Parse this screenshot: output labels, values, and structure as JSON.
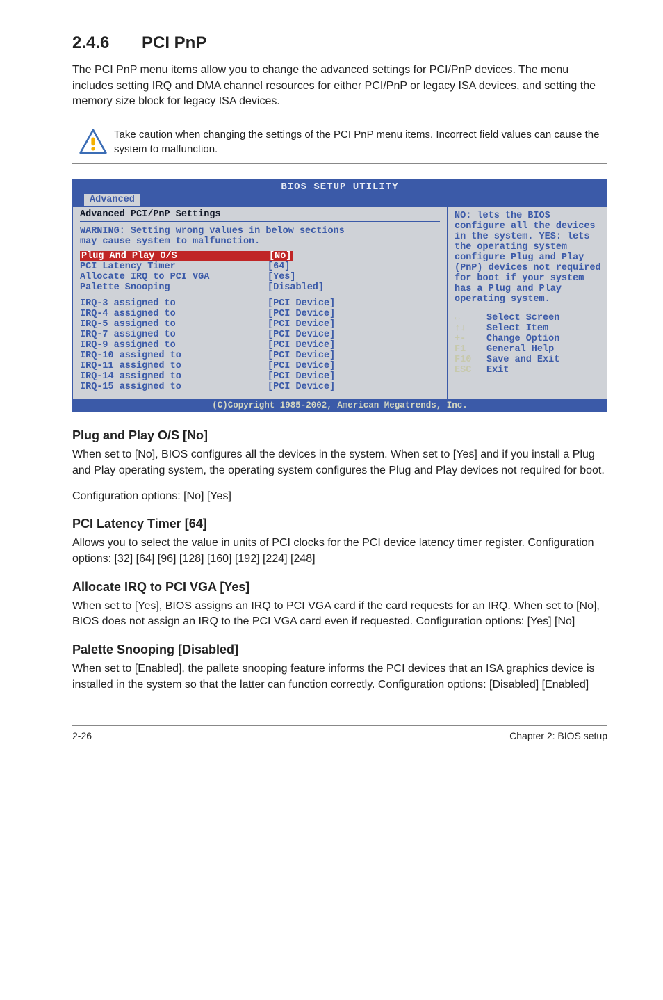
{
  "section": {
    "number": "2.4.6",
    "title": "PCI PnP"
  },
  "intro": "The PCI PnP menu items allow you to change the advanced settings for PCI/PnP devices. The menu includes setting IRQ and DMA channel resources for either PCI/PnP or legacy ISA devices, and setting the memory size block for legacy ISA devices.",
  "callout": "Take caution when changing the settings of the PCI PnP menu items. Incorrect field values can cause the system to malfunction.",
  "bios": {
    "titlebar": "BIOS SETUP UTILITY",
    "tab": "Advanced",
    "panel_title": "Advanced PCI/PnP Settings",
    "warning_l1": "WARNING: Setting wrong values in below sections",
    "warning_l2": "         may cause system to malfunction.",
    "opts": [
      {
        "label": "Plug And Play O/S",
        "value": "[No]",
        "sel": true
      },
      {
        "label": "PCI Latency Timer",
        "value": "[64]",
        "sel": false
      },
      {
        "label": "Allocate IRQ to PCI VGA",
        "value": "[Yes]",
        "sel": false
      },
      {
        "label": "Palette Snooping",
        "value": "[Disabled]",
        "sel": false
      }
    ],
    "irqs": [
      {
        "label": "IRQ-3 assigned to",
        "value": "[PCI Device]"
      },
      {
        "label": "IRQ-4 assigned to",
        "value": "[PCI Device]"
      },
      {
        "label": "IRQ-5 assigned to",
        "value": "[PCI Device]"
      },
      {
        "label": "IRQ-7 assigned to",
        "value": "[PCI Device]"
      },
      {
        "label": "IRQ-9 assigned to",
        "value": "[PCI Device]"
      },
      {
        "label": "IRQ-10 assigned to",
        "value": "[PCI Device]"
      },
      {
        "label": "IRQ-11 assigned to",
        "value": "[PCI Device]"
      },
      {
        "label": "IRQ-14 assigned to",
        "value": "[PCI Device]"
      },
      {
        "label": "IRQ-15 assigned to",
        "value": "[PCI Device]"
      }
    ],
    "help": "NO: lets the BIOS configure all the devices in the system. YES: lets the operating system configure Plug and Play (PnP) devices not required for boot if your system has a Plug and Play operating system.",
    "keys": [
      {
        "k": "↔",
        "a": "Select Screen"
      },
      {
        "k": "↑↓",
        "a": "Select Item"
      },
      {
        "k": "+-",
        "a": "Change Option"
      },
      {
        "k": "F1",
        "a": "General Help"
      },
      {
        "k": "F10",
        "a": "Save and Exit"
      },
      {
        "k": "ESC",
        "a": "Exit"
      }
    ],
    "footer": "(C)Copyright 1985-2002, American Megatrends, Inc."
  },
  "subs": [
    {
      "title": "Plug and Play O/S [No]",
      "paras": [
        "When set to [No], BIOS configures all the devices in the system. When set to [Yes] and if you install a Plug and Play operating system, the operating system configures the Plug and Play devices not required for boot.",
        "Configuration options: [No] [Yes]"
      ]
    },
    {
      "title": "PCI Latency Timer [64]",
      "paras": [
        "Allows you to select the value in units of PCI clocks for the PCI device latency timer register. Configuration options: [32] [64] [96] [128] [160] [192] [224] [248]"
      ]
    },
    {
      "title": "Allocate IRQ to PCI VGA [Yes]",
      "paras": [
        "When set to [Yes], BIOS assigns an IRQ to PCI VGA card if the card requests for an IRQ. When set to [No], BIOS does not assign an IRQ to the PCI VGA card even if requested. Configuration options: [Yes] [No]"
      ]
    },
    {
      "title": "Palette Snooping [Disabled]",
      "paras": [
        "When set to [Enabled], the pallete snooping feature informs the PCI devices that an ISA graphics device is installed in the system so that the latter can function correctly. Configuration options: [Disabled] [Enabled]"
      ]
    }
  ],
  "footer": {
    "left": "2-26",
    "right": "Chapter 2: BIOS setup"
  }
}
